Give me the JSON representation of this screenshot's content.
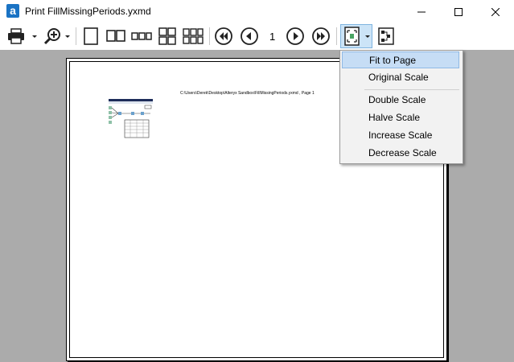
{
  "window": {
    "title": "Print FillMissingPeriods.yxmd",
    "app_icon_letter": "a"
  },
  "toolbar": {
    "page_number": "1",
    "buttons": [
      "print",
      "zoom",
      "single-page",
      "two-pages",
      "three-pages",
      "four-pages",
      "six-pages",
      "first-page",
      "previous-page",
      "next-page",
      "last-page",
      "fit-mode",
      "workflow-layout"
    ]
  },
  "page": {
    "header_text": "C:\\Users\\Derek\\Desktop\\Alteryx Sandbox\\FillMissingPeriods.yxmd ,  Page 1"
  },
  "menu": {
    "items": [
      {
        "label": "Fit to Page",
        "selected": true
      },
      {
        "label": "Original Scale",
        "selected": false
      },
      {
        "label": "Double Scale",
        "selected": false
      },
      {
        "label": "Halve Scale",
        "selected": false
      },
      {
        "label": "Increase Scale",
        "selected": false
      },
      {
        "label": "Decrease Scale",
        "selected": false
      }
    ]
  },
  "colors": {
    "canvas": "#ababab",
    "menu_highlight": "#c6ddf5",
    "app_icon": "#1a73c4"
  }
}
